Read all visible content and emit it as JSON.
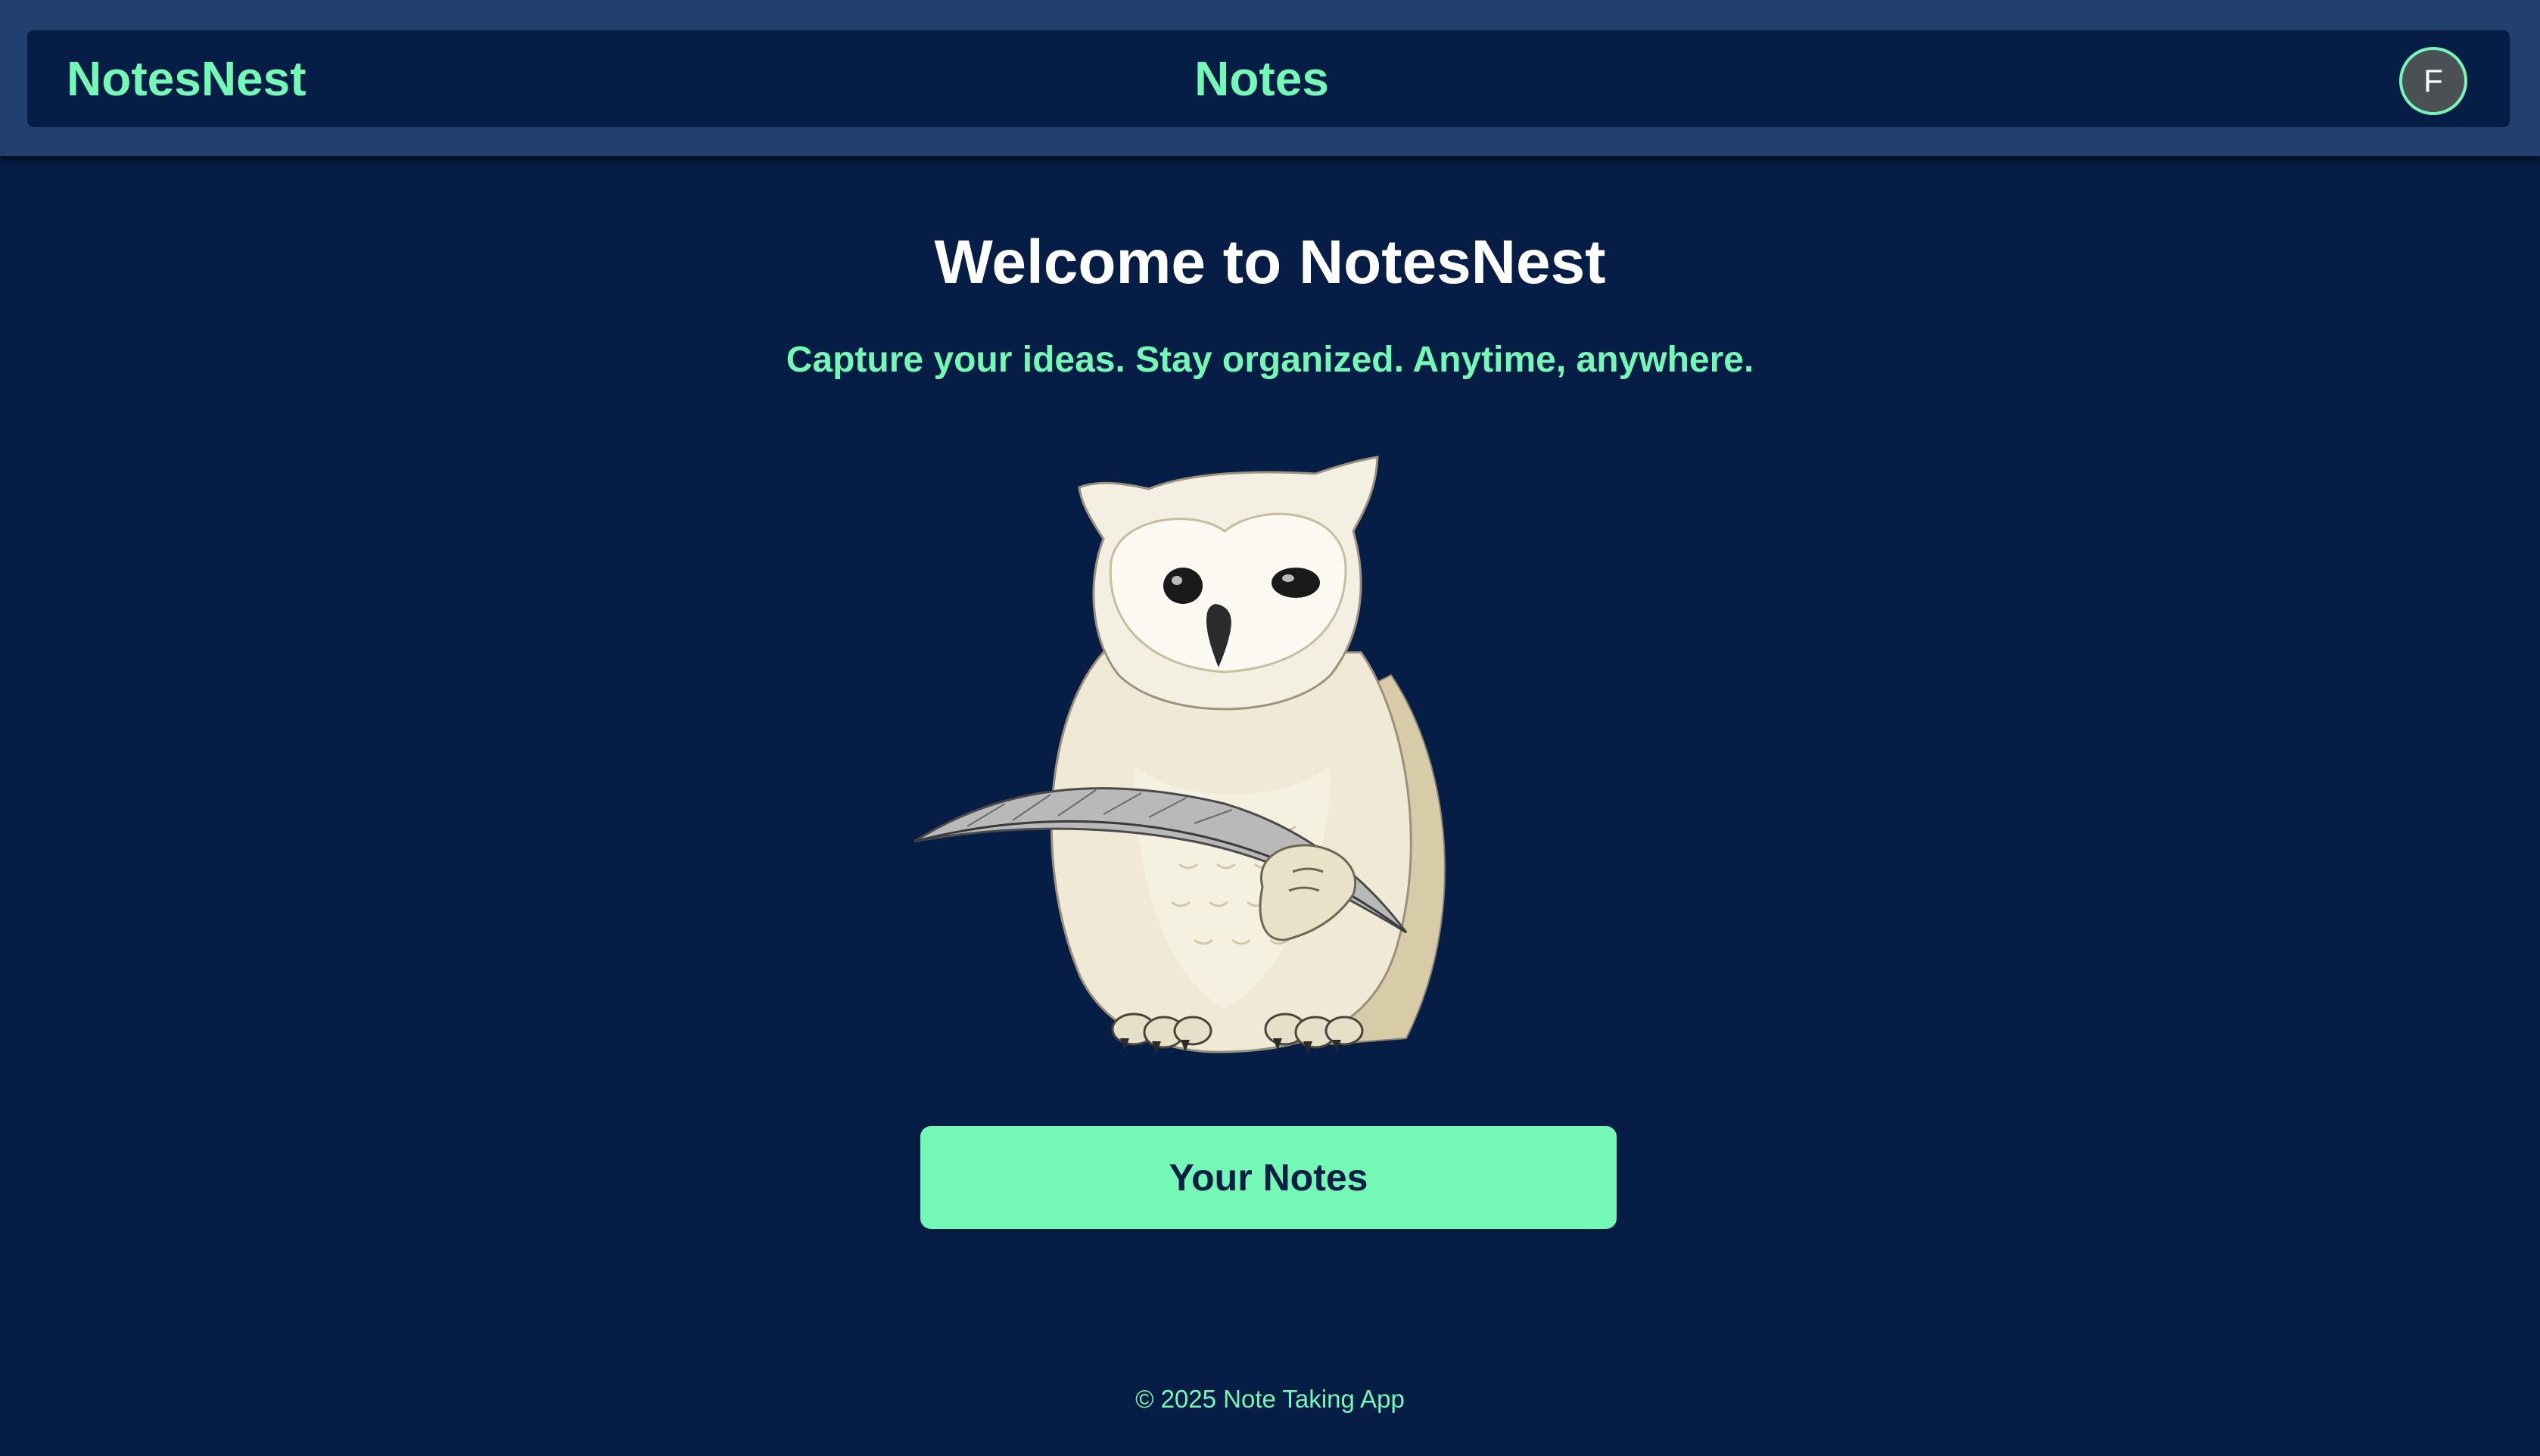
{
  "header": {
    "brand": "NotesNest",
    "title": "Notes",
    "avatar_initial": "F"
  },
  "hero": {
    "heading": "Welcome to NotesNest",
    "tagline": "Capture your ideas. Stay organized. Anytime, anywhere.",
    "image": "owl-with-quill-illustration",
    "cta_label": "Your Notes"
  },
  "footer": {
    "text": "© 2025 Note Taking App"
  },
  "colors": {
    "background": "#061d45",
    "header_band": "#22406f",
    "accent": "#74f8b6",
    "heading": "#ffffff",
    "button_text": "#0b1f45"
  }
}
